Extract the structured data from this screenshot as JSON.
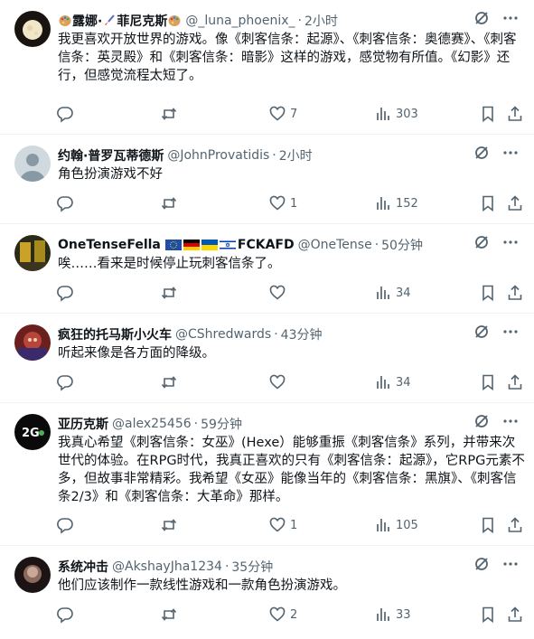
{
  "posts": [
    {
      "name": "露娜·",
      "name2": "菲尼克斯",
      "handle": "@_luna_phoenix_",
      "time": "2小时",
      "text": "我更喜欢开放世界的游戏。像《刺客信条：起源》、《刺客信条：奥德赛》、《刺客信条：英灵殿》和《刺客信条：暗影》这样的游戏，感觉物有所值。《幻影》还行，但感觉流程太短了。",
      "likes": "7",
      "views": "303"
    },
    {
      "name": "约翰·普罗瓦蒂德斯",
      "handle": "@JohnProvatidis",
      "time": "2小时",
      "text": "角色扮演游戏不好",
      "likes": "1",
      "views": "152"
    },
    {
      "name": "OneTenseFella",
      "name2": "FCKAFD",
      "handle": "@OneTense",
      "time": "50分钟",
      "text": "唉……看来是时候停止玩刺客信条了。",
      "likes": "",
      "views": "34"
    },
    {
      "name": "疯狂的托马斯小火车",
      "handle": "@CShredwards",
      "time": "43分钟",
      "text": "听起来像是各方面的降级。",
      "likes": "",
      "views": "34"
    },
    {
      "name": "亚历克斯",
      "handle": "@alex25456",
      "time": "59分钟",
      "text": "我真心希望《刺客信条：女巫》(Hexe）能够重振《刺客信条》系列，并带来次世代的体验。在RPG时代，我真正喜欢的只有《刺客信条：起源》，它RPG元素不多，但故事非常精彩。我希望《女巫》能像当年的《刺客信条：黑旗》、《刺客信条2/3》和《刺客信条：大革命》那样。",
      "likes": "1",
      "views": "105"
    },
    {
      "name": "系统冲击",
      "handle": "@AkshayJha1234",
      "time": "35分钟",
      "text": "他们应该制作一款线性游戏和一款角色扮演游戏。",
      "likes": "2",
      "views": "33"
    }
  ],
  "icons": {
    "reply": "reply-icon",
    "repost": "repost-icon",
    "like": "heart-icon",
    "views": "views-icon",
    "bookmark": "bookmark-icon",
    "share": "share-icon",
    "grok": "grok-icon",
    "more": "more-icon"
  }
}
